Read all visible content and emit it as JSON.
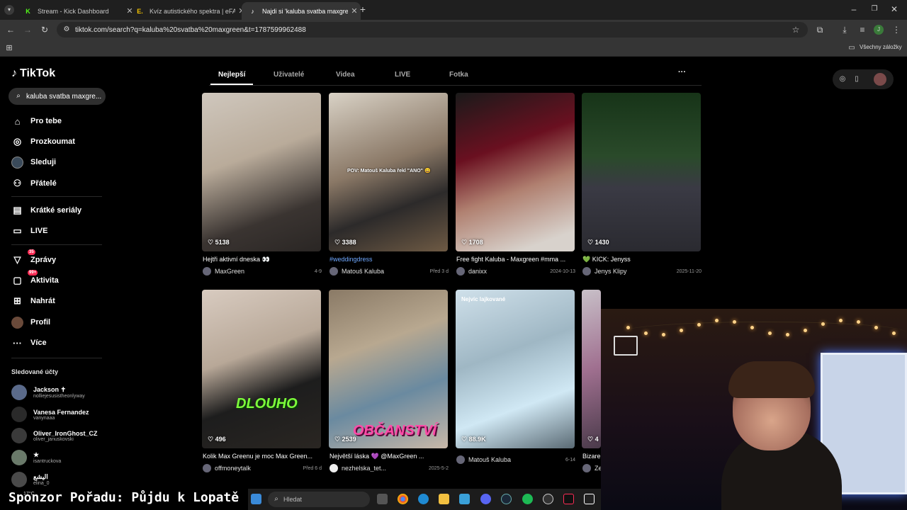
{
  "browser": {
    "tabs": [
      {
        "title": "Stream - Kick Dashboard",
        "favicon": "K",
        "color": "#53fc18"
      },
      {
        "title": "Kvíz autistického spektra | eFAQ",
        "favicon": "E.",
        "color": "#f5c400"
      },
      {
        "title": "Najdi si 'kaluba svatba maxgreen'",
        "favicon": "♪",
        "color": "#ffffff"
      }
    ],
    "url": "tiktok.com/search?q=kaluba%20svatba%20maxgreen&t=1787599962488",
    "bookmarks_label": "Všechny záložky",
    "profile_initial": "J"
  },
  "tiktok": {
    "logo": "TikTok",
    "search_value": "kaluba svatba maxgre...",
    "nav": [
      {
        "label": "Pro tebe",
        "icon": "home-icon"
      },
      {
        "label": "Prozkoumat",
        "icon": "compass-icon"
      },
      {
        "label": "Sleduji",
        "icon": "following-icon"
      },
      {
        "label": "Přátelé",
        "icon": "friends-icon"
      },
      {
        "label": "Krátké seriály",
        "icon": "series-icon"
      },
      {
        "label": "LIVE",
        "icon": "live-icon"
      },
      {
        "label": "Zprávy",
        "icon": "messages-icon",
        "badge": "35"
      },
      {
        "label": "Aktivita",
        "icon": "activity-icon",
        "badge": "99+"
      },
      {
        "label": "Nahrát",
        "icon": "upload-icon"
      },
      {
        "label": "Profil",
        "icon": "profile-icon"
      },
      {
        "label": "Více",
        "icon": "more-icon"
      }
    ],
    "following_header": "Sledované účty",
    "following": [
      {
        "name": "Jackson ✝",
        "handle": "nolliejesusistheonlyway"
      },
      {
        "name": "Vanesa Fernandez",
        "handle": "vanynaaa"
      },
      {
        "name": "Oliver_IronGhost_CZ",
        "handle": "oliver_januskovski"
      },
      {
        "name": "★",
        "handle": "isantruckova"
      },
      {
        "name": "الیشع",
        "handle": "elina_0"
      }
    ],
    "tabs": [
      "Nejlepší",
      "Uživatelé",
      "Videa",
      "LIVE",
      "Fotka"
    ],
    "more": "···",
    "videos": [
      {
        "likes": "5138",
        "caption": "Hejtři aktivní dneska 👀",
        "author": "MaxGreen",
        "date": "4-9",
        "bg": "linear-gradient(160deg,#cfc7bd 0%,#b9ab9a 40%,#3a3431 75%,#2a2624 100%)"
      },
      {
        "likes": "3388",
        "caption": "#weddingdress",
        "author": "Matouš Kaluba",
        "date": "Před 3 d",
        "overlay": "POV: Matouš Kaluba řekl \"ANO\" 😄",
        "bg": "linear-gradient(160deg,#d9d2c6 0%,#8a7866 45%,#2c2a2a 70%,#6e5a44 100%)"
      },
      {
        "likes": "1708",
        "caption": "Free fight Kaluba - Maxgreen #mma ...",
        "author": "danixx",
        "date": "2024-10-13",
        "bg": "linear-gradient(160deg,#1a1a1a 0%,#6a1020 35%,#b08070 60%,#d8d2cc 90%)"
      },
      {
        "likes": "1430",
        "caption": "💚 KICK: Jenyss",
        "author": "Jenys Klipy",
        "date": "2025-11-20",
        "bg": "linear-gradient(180deg,#173418 0%,#2a4a2a 40%,#3a3a44 60%,#2a2a30 100%)"
      },
      {
        "likes": "496",
        "caption": "Kolik Max Greenu je moc Max Green...",
        "author": "offmoneytalk",
        "date": "Před 6 d",
        "overlay": "DLOUHO",
        "bg": "linear-gradient(160deg,#d8cbc0 0%,#b8a898 40%,#1d1d1d 65%,#2a2622 100%)"
      },
      {
        "likes": "2539",
        "caption": "Největší láska 💜 @MaxGreen ...",
        "author": "nezhelska_tet...",
        "date": "2025-5-2",
        "overlay": "OBČANSTVÍ",
        "bg": "linear-gradient(160deg,#8a7a66 0%,#b8a890 35%,#6a8aa0 65%,#c8b8a8 100%)"
      },
      {
        "likes": "88.9K",
        "caption": "",
        "author": "Matouš Kaluba",
        "date": "6-14",
        "toptag": "Nejvíc lajkované",
        "bg": "linear-gradient(160deg,#cfe0ea 0%,#9fb7c4 40%,#d0e8f4 70%,#5a6a74 100%)"
      },
      {
        "likes": "4",
        "caption": "Bizare",
        "author": "Ze",
        "date": "",
        "bg": "linear-gradient(160deg,#c8c0c8 0%,#a07090 50%,#4a3a4a 100%)"
      }
    ]
  },
  "stream": {
    "sponsor_text": "Sponzor Pořadu: Půjdu k Lopatě",
    "weather": "17°C"
  },
  "taskbar": {
    "search_placeholder": "Hledat"
  }
}
